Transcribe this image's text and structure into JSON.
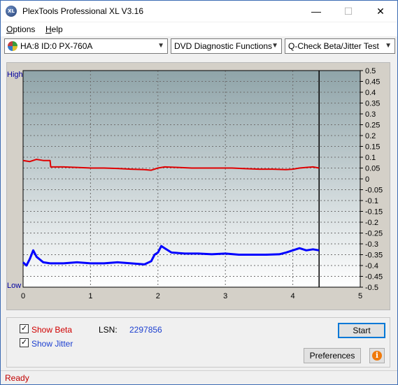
{
  "window": {
    "title": "PlexTools Professional XL V3.16",
    "icon_text": "XL",
    "controls": {
      "minimize": "—",
      "maximize": "☐",
      "close": "✕"
    }
  },
  "menu": [
    {
      "label": "Options",
      "mnemonic": "O",
      "rest": "ptions"
    },
    {
      "label": "Help",
      "mnemonic": "H",
      "rest": "elp"
    }
  ],
  "toolbar": {
    "drive": "HA:8 ID:0  PX-760A",
    "function": "DVD Diagnostic Functions",
    "test": "Q-Check Beta/Jitter Test"
  },
  "chart_data": {
    "type": "line",
    "left_axis_labels": {
      "top": "High",
      "bottom": "Low"
    },
    "xlim": [
      0,
      5
    ],
    "x_ticks": [
      "0",
      "1",
      "2",
      "3",
      "4",
      "5"
    ],
    "ylim": [
      -0.5,
      0.5
    ],
    "y_ticks": [
      "0.5",
      "0.45",
      "0.4",
      "0.35",
      "0.3",
      "0.25",
      "0.2",
      "0.15",
      "0.1",
      "0.05",
      "0",
      "-0.05",
      "-0.1",
      "-0.15",
      "-0.2",
      "-0.25",
      "-0.3",
      "-0.35",
      "-0.4",
      "-0.45",
      "-0.5"
    ],
    "grid": true,
    "end_marker_x": 4.39,
    "series": [
      {
        "color": "#e00000",
        "points": [
          [
            0.0,
            0.085
          ],
          [
            0.1,
            0.08
          ],
          [
            0.2,
            0.09
          ],
          [
            0.3,
            0.085
          ],
          [
            0.4,
            0.085
          ],
          [
            0.41,
            0.055
          ],
          [
            0.6,
            0.055
          ],
          [
            0.8,
            0.053
          ],
          [
            1.0,
            0.05
          ],
          [
            1.2,
            0.05
          ],
          [
            1.4,
            0.048
          ],
          [
            1.6,
            0.045
          ],
          [
            1.8,
            0.043
          ],
          [
            1.9,
            0.04
          ],
          [
            2.0,
            0.05
          ],
          [
            2.1,
            0.055
          ],
          [
            2.3,
            0.053
          ],
          [
            2.5,
            0.05
          ],
          [
            2.7,
            0.05
          ],
          [
            2.9,
            0.05
          ],
          [
            3.1,
            0.05
          ],
          [
            3.3,
            0.047
          ],
          [
            3.5,
            0.045
          ],
          [
            3.7,
            0.045
          ],
          [
            3.9,
            0.043
          ],
          [
            4.0,
            0.045
          ],
          [
            4.1,
            0.05
          ],
          [
            4.2,
            0.053
          ],
          [
            4.3,
            0.055
          ],
          [
            4.39,
            0.05
          ]
        ]
      },
      {
        "color": "#0000ff",
        "points": [
          [
            0.0,
            -0.385
          ],
          [
            0.05,
            -0.4
          ],
          [
            0.1,
            -0.37
          ],
          [
            0.15,
            -0.33
          ],
          [
            0.2,
            -0.36
          ],
          [
            0.3,
            -0.385
          ],
          [
            0.4,
            -0.39
          ],
          [
            0.6,
            -0.39
          ],
          [
            0.8,
            -0.385
          ],
          [
            1.0,
            -0.39
          ],
          [
            1.2,
            -0.39
          ],
          [
            1.4,
            -0.385
          ],
          [
            1.6,
            -0.39
          ],
          [
            1.8,
            -0.395
          ],
          [
            1.9,
            -0.38
          ],
          [
            1.95,
            -0.35
          ],
          [
            2.0,
            -0.34
          ],
          [
            2.05,
            -0.31
          ],
          [
            2.1,
            -0.32
          ],
          [
            2.2,
            -0.34
          ],
          [
            2.4,
            -0.345
          ],
          [
            2.6,
            -0.345
          ],
          [
            2.8,
            -0.348
          ],
          [
            3.0,
            -0.345
          ],
          [
            3.2,
            -0.35
          ],
          [
            3.4,
            -0.35
          ],
          [
            3.6,
            -0.35
          ],
          [
            3.8,
            -0.348
          ],
          [
            3.9,
            -0.34
          ],
          [
            4.0,
            -0.33
          ],
          [
            4.1,
            -0.32
          ],
          [
            4.2,
            -0.33
          ],
          [
            4.3,
            -0.325
          ],
          [
            4.39,
            -0.33
          ]
        ]
      }
    ]
  },
  "options": {
    "show_beta": {
      "label": "Show Beta",
      "mnemonic": "B",
      "checked": true,
      "color": "#d00000"
    },
    "show_jitter": {
      "label": "Show Jitter",
      "mnemonic": "J",
      "checked": true,
      "color": "#1c3fd0"
    }
  },
  "lsn": {
    "label": "LSN:",
    "value": "2297856"
  },
  "buttons": {
    "start": "Start",
    "preferences": "Preferences",
    "info_icon": "i"
  },
  "status": "Ready",
  "colors": {
    "plot_top": "#8fa4a9",
    "plot_bottom": "#ffffff",
    "beta": "#e00000",
    "jitter": "#0000ff",
    "axis_label": "#0000a0"
  }
}
